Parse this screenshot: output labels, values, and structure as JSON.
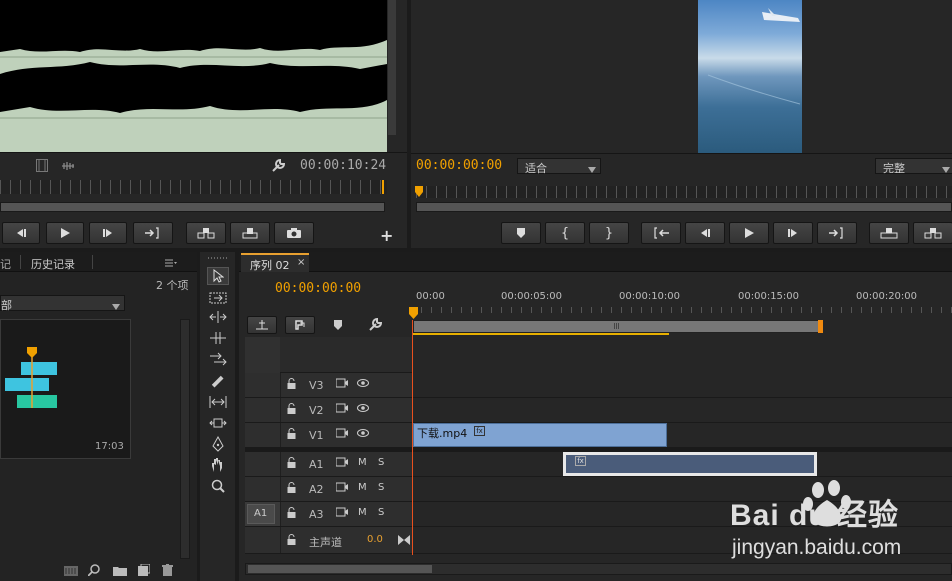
{
  "source_monitor": {
    "timecode": "00:00:10:24"
  },
  "program_monitor": {
    "timecode": "00:00:00:00",
    "fit_label": "适合",
    "quality_label": "完整"
  },
  "history_panel": {
    "tab_partial": "记",
    "tab_history": "历史记录",
    "item_count": "2 个项",
    "bin_partial": "部",
    "clip_duration": "17:03"
  },
  "sequence": {
    "tab_label": "序列 02",
    "timecode": "00:00:00:00",
    "ruler_labels": [
      "00:00",
      "00:00:05:00",
      "00:00:10:00",
      "00:00:15:00",
      "00:00:20:00"
    ],
    "video_tracks": [
      "V3",
      "V2",
      "V1"
    ],
    "audio_tracks": [
      "A1",
      "A2",
      "A3"
    ],
    "source_patch": "A1",
    "master_label": "主声道",
    "master_value": "0.0",
    "mute_label": "M",
    "solo_label": "S",
    "video_clip_label": "下载.mp4",
    "fx_label": "fx"
  },
  "colors": {
    "timecode": "#f0a000",
    "video_clip": "#7fa3d2",
    "audio_clip": "#4a5c7a",
    "waveform_bg": "#bfd1bb",
    "playhead": "#e8501e"
  },
  "watermark": {
    "brand": "Bai du 经验",
    "url": "jingyan.baidu.com"
  }
}
